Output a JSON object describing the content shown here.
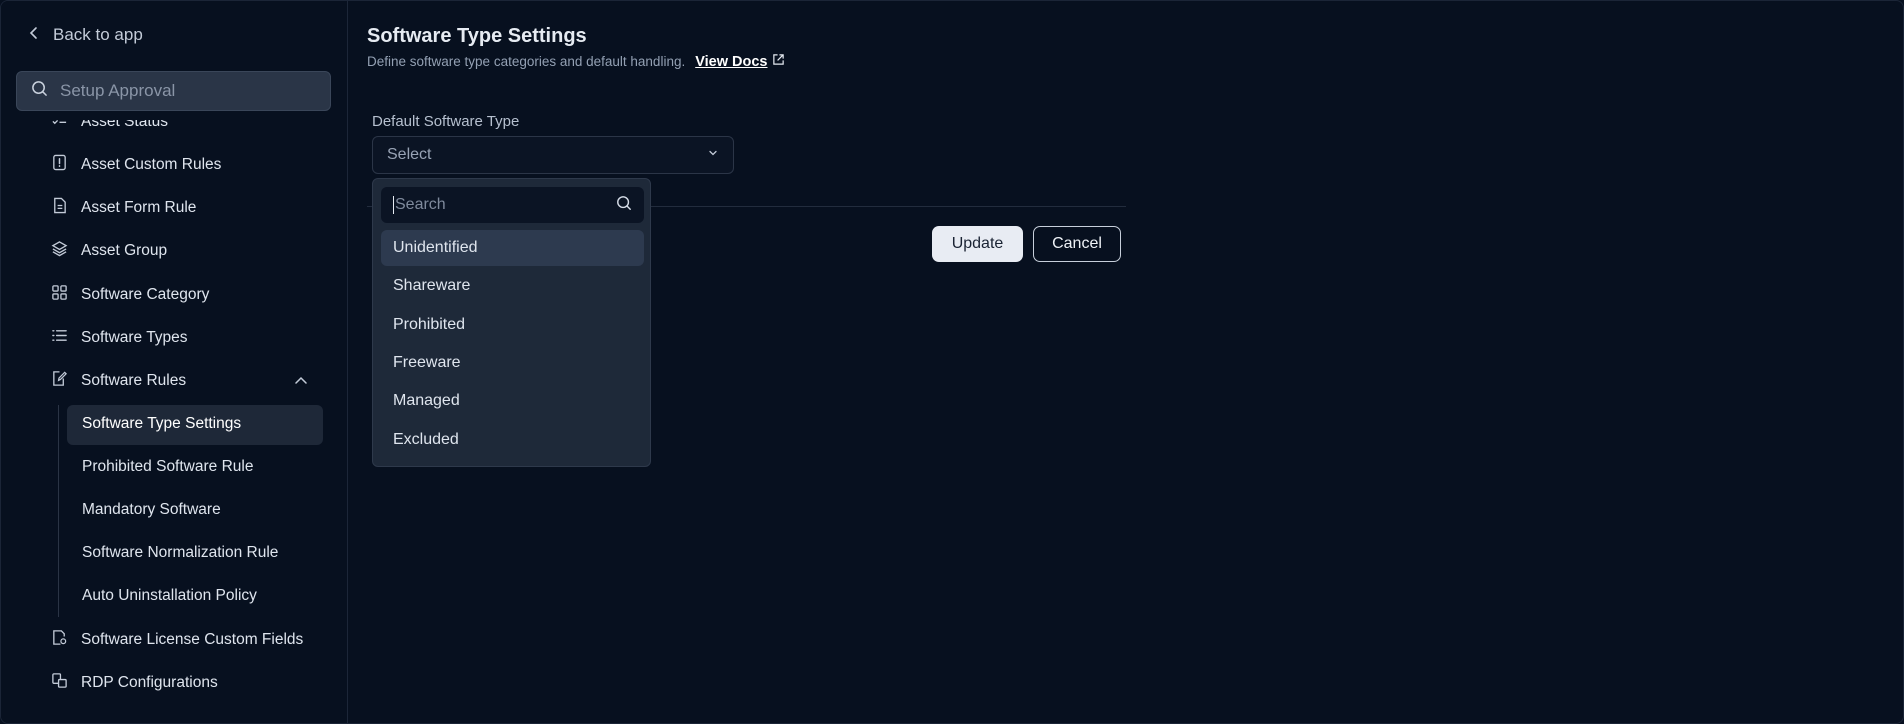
{
  "sidebar": {
    "back_label": "Back to app",
    "search_placeholder": "Setup Approval",
    "items": [
      {
        "label": "Asset Status"
      },
      {
        "label": "Asset Custom Rules"
      },
      {
        "label": "Asset Form Rule"
      },
      {
        "label": "Asset Group"
      },
      {
        "label": "Software Category"
      },
      {
        "label": "Software Types"
      },
      {
        "label": "Software Rules"
      },
      {
        "label": "Software License Custom Fields"
      },
      {
        "label": "RDP Configurations"
      }
    ],
    "sub_items": [
      {
        "label": "Software Type Settings",
        "active": true
      },
      {
        "label": "Prohibited Software Rule"
      },
      {
        "label": "Mandatory Software"
      },
      {
        "label": "Software Normalization Rule"
      },
      {
        "label": "Auto Uninstallation Policy"
      }
    ]
  },
  "main": {
    "title": "Software Type Settings",
    "description": "Define software type categories and default handling.",
    "docs_link": "View Docs",
    "field_label": "Default Software Type",
    "select_value": "Select",
    "update_label": "Update",
    "cancel_label": "Cancel"
  },
  "dropdown": {
    "search_placeholder": "Search",
    "options": [
      "Unidentified",
      "Shareware",
      "Prohibited",
      "Freeware",
      "Managed",
      "Excluded"
    ],
    "highlighted": "Unidentified"
  },
  "colors": {
    "background": "#07101f",
    "surface": "#1e2939",
    "accent_button": "#e8ecf3"
  }
}
